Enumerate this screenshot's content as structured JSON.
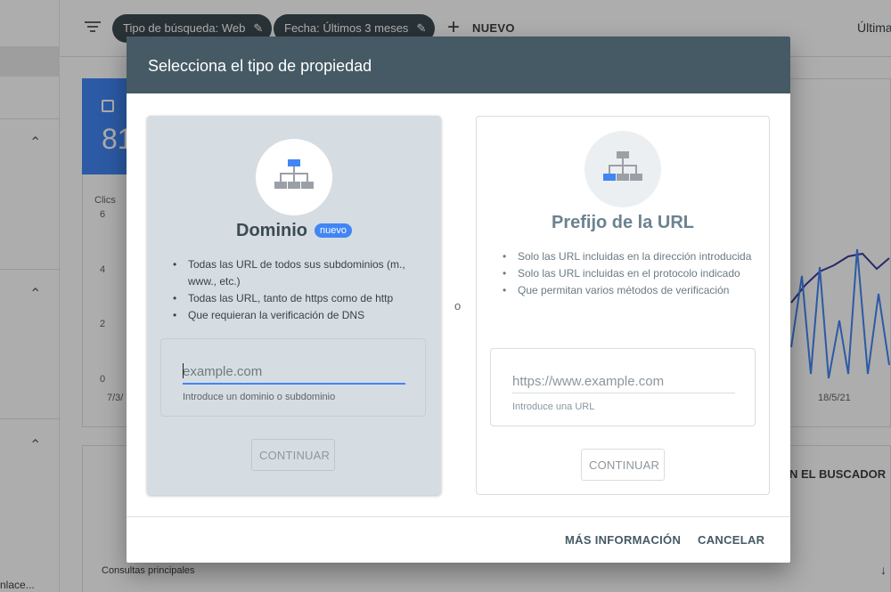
{
  "app": {
    "filters": [
      {
        "label": "Tipo de búsqueda: Web",
        "icon": "pencil-icon"
      },
      {
        "label": "Fecha: Últimos 3 meses",
        "icon": "pencil-icon"
      }
    ],
    "new_label": "NUEVO",
    "last_updated_label": "Últimа",
    "card_number": "81",
    "chart": {
      "ylabel": "Clics",
      "yticks": [
        "6",
        "4",
        "2",
        "0"
      ],
      "xticks": [
        "7/3/",
        "18/5/21"
      ]
    },
    "bottom_card": {
      "tab_label": "N EL BUSCADOR",
      "queries_label": "Consultas principales"
    },
    "rail_text": "nlace..."
  },
  "dialog": {
    "title": "Selecciona el tipo de propiedad",
    "separator": "o",
    "domain": {
      "title": "Dominio",
      "badge": "nuevo",
      "bullets": [
        "Todas las URL de todos sus subdominios (m., www., etc.)",
        "Todas las URL, tanto de https como de http",
        "Que requieran la verificación de DNS"
      ],
      "input_placeholder": "example.com",
      "input_value": "",
      "helper": "Introduce un dominio o subdominio",
      "button": "CONTINUAR"
    },
    "url_prefix": {
      "title": "Prefijo de la URL",
      "bullets": [
        "Solo las URL incluidas en la dirección introducida",
        "Solo las URL incluidas en el protocolo indicado",
        "Que permitan varios métodos de verificación"
      ],
      "input_placeholder": "https://www.example.com",
      "input_value": "",
      "helper": "Introduce una URL",
      "button": "CONTINUAR"
    },
    "footer": {
      "info_button": "MÁS INFORMACIÓN",
      "cancel_button": "CANCELAR"
    }
  },
  "colors": {
    "header": "#455a64",
    "accent": "#4285f4",
    "selected_card": "#d5dde2",
    "chip": "#3c4a52"
  }
}
